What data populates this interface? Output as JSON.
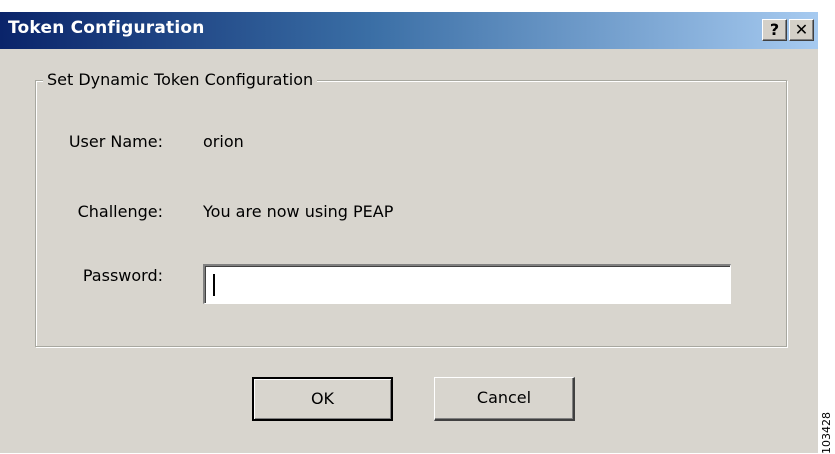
{
  "window": {
    "title": "Token Configuration",
    "help_button": "?",
    "close_button": "✕"
  },
  "group": {
    "legend": "Set Dynamic Token Configuration"
  },
  "fields": {
    "user_name_label": "User Name:",
    "user_name_value": "orion",
    "challenge_label": "Challenge:",
    "challenge_value": "You are now using PEAP",
    "password_label": "Password:",
    "password_value": ""
  },
  "buttons": {
    "ok": "OK",
    "cancel": "Cancel"
  },
  "figure_id": "103428"
}
